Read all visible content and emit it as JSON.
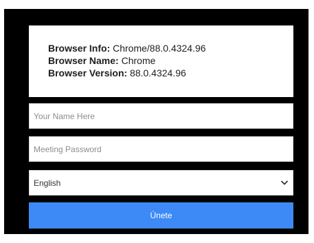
{
  "browser_info": {
    "info_label": "Browser Info:",
    "info_value": "Chrome/88.0.4324.96",
    "name_label": "Browser Name:",
    "name_value": "Chrome",
    "version_label": "Browser Version:",
    "version_value": "88.0.4324.96"
  },
  "form": {
    "name_placeholder": "Your Name Here",
    "password_placeholder": "Meeting Password",
    "language_selected": "English",
    "join_label": "Únete"
  },
  "colors": {
    "background": "#000000",
    "accent": "#3d8af7"
  },
  "icons": {
    "dropdown": "chevron-down-icon"
  }
}
